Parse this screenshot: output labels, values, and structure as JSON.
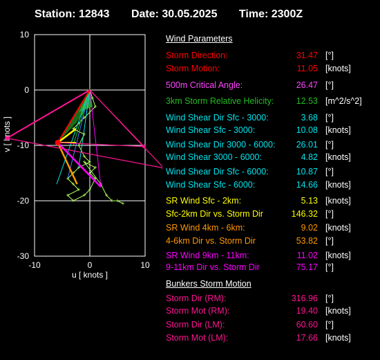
{
  "header": {
    "station": "Station: 12843",
    "date": "Date: 30.05.2025",
    "time": "Time: 2300Z"
  },
  "hodograph": {
    "x_label": "u  [ knots ]",
    "y_label": "v  [ knots ]",
    "x_ticks": [
      "-10",
      "0",
      "10"
    ],
    "y_ticks": [
      "10",
      "0",
      "-10",
      "-20",
      "-30"
    ]
  },
  "chart_data": {
    "type": "scatter",
    "title": "",
    "xlabel": "u  [ knots ]",
    "ylabel": "v  [ knots ]",
    "xlim": [
      -10,
      10
    ],
    "ylim": [
      -30,
      10
    ],
    "grid": true,
    "hodograph_trace": [
      [
        0,
        0
      ],
      [
        0.5,
        -1.5
      ],
      [
        1,
        -3
      ],
      [
        -1,
        -5
      ],
      [
        -2,
        -6
      ],
      [
        -3,
        -7
      ],
      [
        -1,
        -8
      ],
      [
        -2,
        -10
      ],
      [
        -1,
        -12
      ],
      [
        0,
        -13
      ],
      [
        -2,
        -14
      ],
      [
        -3,
        -15
      ],
      [
        -4,
        -16
      ],
      [
        -3,
        -17
      ],
      [
        -2,
        -18
      ],
      [
        -4,
        -19
      ],
      [
        -3,
        -20
      ],
      [
        -1,
        -19
      ],
      [
        0,
        -18
      ],
      [
        1,
        -16
      ],
      [
        0,
        -15
      ],
      [
        1,
        -14
      ],
      [
        -1,
        -13
      ],
      [
        2,
        -17
      ],
      [
        3,
        -19
      ],
      [
        4,
        -20
      ],
      [
        5,
        -20
      ],
      [
        6,
        -20.5
      ]
    ],
    "storm_motion_point": [
      -5.8,
      -9.5
    ],
    "bunkers_rm_point": [
      -15,
      -8.7
    ],
    "bunkers_lm_point": [
      13.4,
      -14.1
    ],
    "right_mover_point": [
      9.8,
      -10.2
    ]
  },
  "colors": {
    "red": "#ff0000",
    "magenta": "#ff00ff",
    "pink": "#ff1493",
    "green": "#22aa22",
    "cyan": "#00e5ee",
    "yellow": "#ffff00",
    "orange": "#ff9900",
    "lightgreen": "#b0ff60"
  },
  "params": {
    "wind_title": "Wind Parameters",
    "storm_direction": {
      "label": "Storm Direction:",
      "value": "31.47",
      "unit": "[°]"
    },
    "storm_motion": {
      "label": "Storm Motion:",
      "value": "11.05",
      "unit": "[knots]"
    },
    "critical_angle": {
      "label": "500m Critical Angle:",
      "value": "26.47",
      "unit": "[°]"
    },
    "srh": {
      "label": "3km Storm Relative Helicity:",
      "value": "12.53",
      "unit": "[m^2/s^2]"
    },
    "ws_dir_0_3": {
      "label": "Wind Shear Dir Sfc - 3000:",
      "value": "3.68",
      "unit": "[°]"
    },
    "ws_0_3": {
      "label": "Wind Shear Sfc - 3000:",
      "value": "10.08",
      "unit": "[knots]"
    },
    "ws_dir_3_6": {
      "label": "Wind Shear Dir 3000 - 6000:",
      "value": "26.01",
      "unit": "[°]"
    },
    "ws_3_6": {
      "label": "Wind Shear 3000 - 6000:",
      "value": "4.82",
      "unit": "[knots]"
    },
    "ws_dir_0_6": {
      "label": "Wind Shear Dir Sfc - 6000:",
      "value": "10.87",
      "unit": "[°]"
    },
    "ws_0_6": {
      "label": "Wind Shear Sfc - 6000:",
      "value": "14.66",
      "unit": "[knots]"
    },
    "sr_0_2": {
      "label": "SR Wind Sfc - 2km:",
      "value": "5.13",
      "unit": "[knots]"
    },
    "sr_0_2_dir": {
      "label": "Sfc-2km Dir vs. Storm Dir",
      "value": "146.32",
      "unit": "[°]"
    },
    "sr_4_6": {
      "label": "SR Wind 4km - 6km:",
      "value": "9.02",
      "unit": "[knots]"
    },
    "sr_4_6_dir": {
      "label": "4-6km Dir vs. Storm Dir",
      "value": "53.82",
      "unit": "[°]"
    },
    "sr_9_11": {
      "label": "SR Wind 9km - 11km:",
      "value": "11.02",
      "unit": "[knots]"
    },
    "sr_9_11_dir": {
      "label": "9-11km Dir vs. Storm Dir",
      "value": "75.17",
      "unit": "[°]"
    },
    "bunkers_title": "Bunkers Storm Motion",
    "rm_dir": {
      "label": "Storm Dir (RM):",
      "value": "316.96",
      "unit": "[°]"
    },
    "rm_mot": {
      "label": "Storm Mot (RM):",
      "value": "19.40",
      "unit": "[knots]"
    },
    "lm_dir": {
      "label": "Storm Dir (LM):",
      "value": "60.60",
      "unit": "[°]"
    },
    "lm_mot": {
      "label": "Storm Mot (LM):",
      "value": "17.66",
      "unit": "[knots]"
    }
  }
}
